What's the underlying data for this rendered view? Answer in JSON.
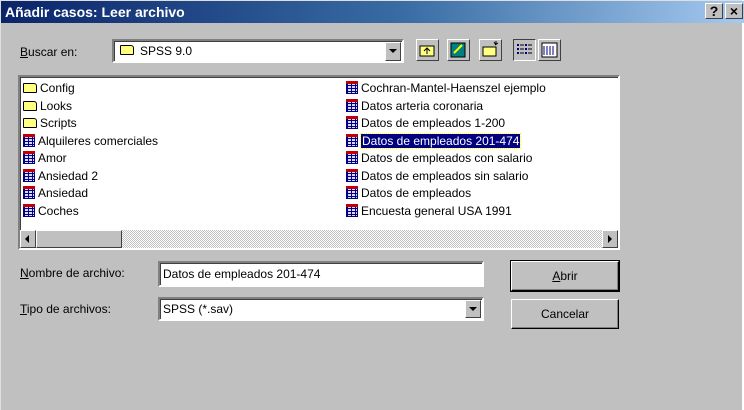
{
  "window": {
    "title": "Añadir casos: Leer archivo",
    "help_button": "?",
    "close_button": "×"
  },
  "lookin": {
    "label_accel": "B",
    "label_rest": "uscar en:",
    "value": "SPSS 9.0"
  },
  "files": [
    {
      "name": "Config",
      "type": "folder",
      "selected": false
    },
    {
      "name": "Looks",
      "type": "folder",
      "selected": false
    },
    {
      "name": "Scripts",
      "type": "folder",
      "selected": false
    },
    {
      "name": "Alquileres comerciales",
      "type": "sav",
      "selected": false
    },
    {
      "name": "Amor",
      "type": "sav",
      "selected": false
    },
    {
      "name": "Ansiedad 2",
      "type": "sav",
      "selected": false
    },
    {
      "name": "Ansiedad",
      "type": "sav",
      "selected": false
    },
    {
      "name": "Coches",
      "type": "sav",
      "selected": false
    },
    {
      "name": "Cochran-Mantel-Haenszel ejemplo",
      "type": "sav",
      "selected": false
    },
    {
      "name": "Datos arteria coronaria",
      "type": "sav",
      "selected": false
    },
    {
      "name": "Datos de empleados 1-200",
      "type": "sav",
      "selected": false
    },
    {
      "name": "Datos de empleados 201-474",
      "type": "sav",
      "selected": true
    },
    {
      "name": "Datos de empleados con salario",
      "type": "sav",
      "selected": false
    },
    {
      "name": "Datos de empleados sin salario",
      "type": "sav",
      "selected": false
    },
    {
      "name": "Datos de empleados",
      "type": "sav",
      "selected": false
    },
    {
      "name": "Encuesta general USA 1991",
      "type": "sav",
      "selected": false
    }
  ],
  "filename": {
    "label_accel": "N",
    "label_rest": "ombre de archivo:",
    "value": "Datos de empleados 201-474"
  },
  "filetype": {
    "label_accel": "T",
    "label_rest": "ipo de archivos:",
    "value": "SPSS (*.sav)"
  },
  "buttons": {
    "open_accel": "A",
    "open_rest": "brir",
    "cancel": "Cancelar"
  },
  "colors": {
    "selection": "#000080",
    "dialog_bg": "#c0c0c0",
    "title_start": "#0a246a"
  }
}
